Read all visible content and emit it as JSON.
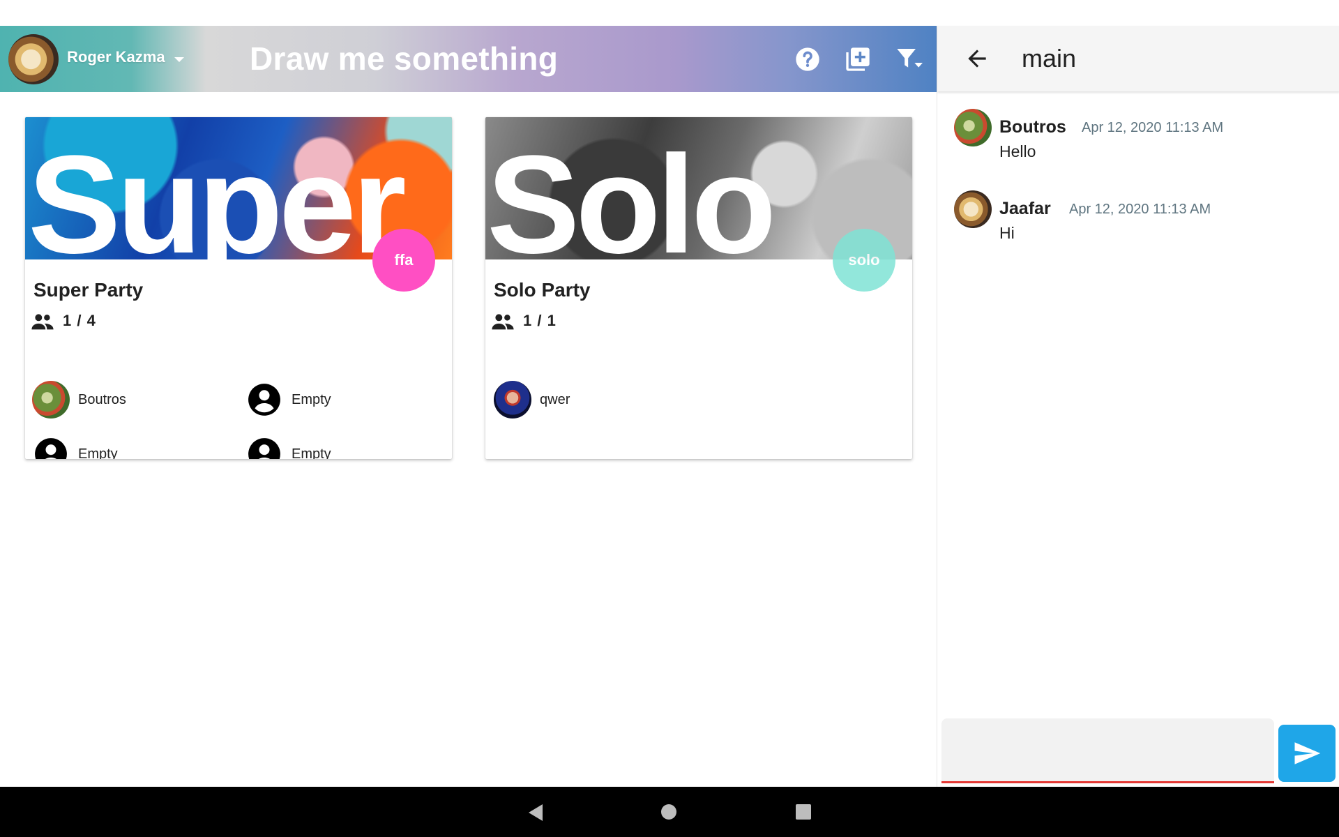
{
  "header": {
    "user_name": "Roger Kazma",
    "app_title": "Draw me something",
    "icons": [
      "help-icon",
      "add-party-icon",
      "filter-icon"
    ]
  },
  "parties": [
    {
      "banner_word": "Super",
      "title": "Super Party",
      "mode": "ffa",
      "mode_color": "#ff4fc3",
      "players": "1 / 4",
      "slots": [
        {
          "name": "Boutros",
          "filled": true
        },
        {
          "name": "Empty",
          "filled": false
        },
        {
          "name": "Empty",
          "filled": false
        },
        {
          "name": "Empty",
          "filled": false
        }
      ]
    },
    {
      "banner_word": "Solo",
      "title": "Solo Party",
      "mode": "solo",
      "mode_color": "#7fe3d5",
      "players": "1 / 1",
      "slots": [
        {
          "name": "qwer",
          "filled": true
        }
      ]
    }
  ],
  "chat": {
    "channel": "main",
    "messages": [
      {
        "author": "Boutros",
        "time": "Apr 12, 2020 11:13 AM",
        "text": "Hello"
      },
      {
        "author": "Jaafar",
        "time": "Apr 12, 2020 11:13 AM",
        "text": "Hi"
      }
    ],
    "input_value": "",
    "accent_color": "#1fa6e8",
    "underline_color": "#e53935"
  }
}
